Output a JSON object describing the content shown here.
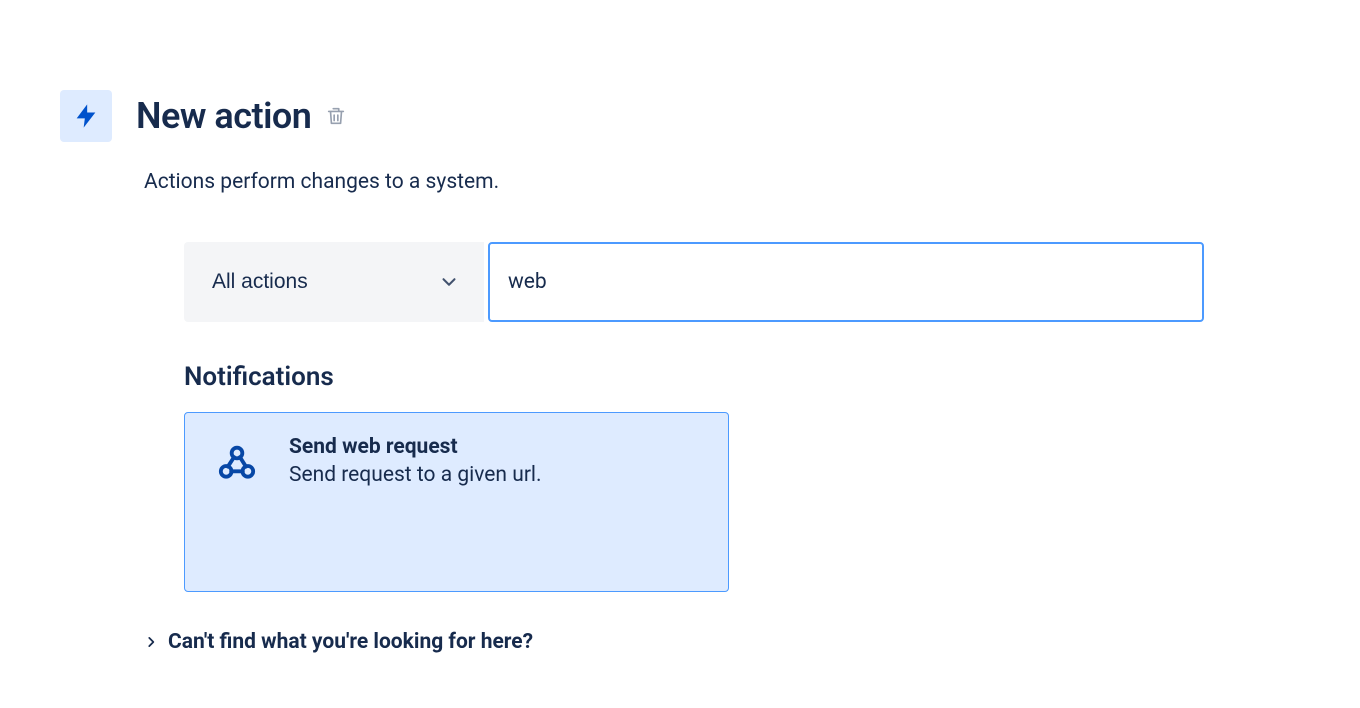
{
  "header": {
    "title": "New action"
  },
  "subtitle": "Actions perform changes to a system.",
  "filter": {
    "dropdown_label": "All actions",
    "search_value": "web"
  },
  "section": {
    "heading": "Notifications"
  },
  "cards": [
    {
      "title": "Send web request",
      "description": "Send request to a given url."
    }
  ],
  "help": {
    "text": "Can't find what you're looking for here?"
  }
}
